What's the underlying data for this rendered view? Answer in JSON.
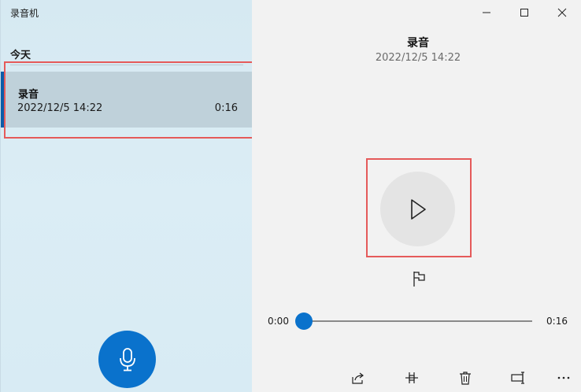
{
  "app": {
    "title": "录音机"
  },
  "list": {
    "section_header": "今天",
    "items": [
      {
        "name": "录音",
        "date": "2022/12/5 14:22",
        "duration": "0:16"
      }
    ]
  },
  "detail": {
    "title": "录音",
    "date": "2022/12/5 14:22"
  },
  "player": {
    "current_time": "0:00",
    "total_time": "0:16",
    "progress": 0.0
  },
  "icons": {
    "window_minimize": "minimize-icon",
    "window_maximize": "maximize-icon",
    "window_close": "close-icon",
    "play": "play-icon",
    "flag": "flag-icon",
    "microphone": "microphone-icon",
    "share": "share-icon",
    "trim": "trim-icon",
    "delete": "trash-icon",
    "rename": "rename-icon",
    "more": "more-icon"
  },
  "colors": {
    "accent": "#0a72cc",
    "selection": "#0c5da8",
    "highlight": "#e55a5a"
  }
}
